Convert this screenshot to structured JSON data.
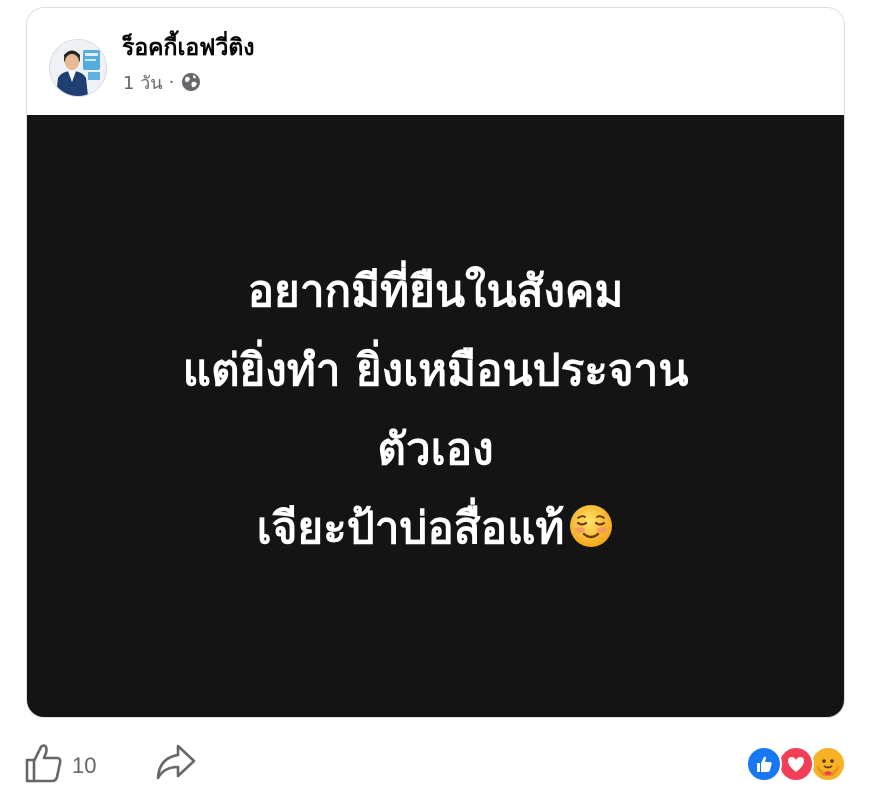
{
  "post": {
    "author_name": "ร็อคกี้เอฟวี่ติง",
    "time_ago": "1 วัน",
    "separator": "·",
    "audience_icon": "globe-icon",
    "text_lines": [
      "อยากมีที่ยืนในสังคม",
      "แต่ยิ่งทำ ยิ่งเหมือนประจาน",
      "ตัวเอง",
      "เจียะป้าบ่อสื่อแท้"
    ],
    "trailing_emoji": "smiling-face-icon",
    "background_color": "#141414"
  },
  "footer": {
    "like_icon": "thumbs-up-icon",
    "like_count": "10",
    "share_icon": "share-arrow-icon",
    "reaction_icons": [
      "like-reaction-icon",
      "love-reaction-icon",
      "care-reaction-icon"
    ]
  },
  "colors": {
    "facebook_blue": "#1877f2",
    "love_red": "#f33e58",
    "care_yellow": "#f7b125",
    "secondary_text": "#65676b"
  }
}
